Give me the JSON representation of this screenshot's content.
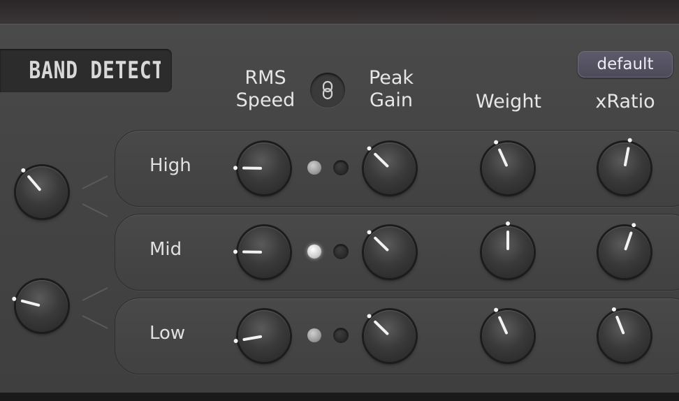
{
  "title": "BAND DETECTOR",
  "headers": {
    "rms_speed": [
      "RMS",
      "Speed"
    ],
    "peak_gain": [
      "Peak",
      "Gain"
    ],
    "weight": "Weight",
    "xratio": "xRatio"
  },
  "default_button": "default",
  "link_icon": "link-chain-icon",
  "side_knobs": [
    {
      "name": "crossover-high-knob",
      "value": 0.35
    },
    {
      "name": "crossover-low-knob",
      "value": 0.22
    }
  ],
  "bands": [
    {
      "label": "High",
      "rms_speed": 0.17,
      "led_rms": "dim",
      "led_peak": "off",
      "peak_gain": 0.33,
      "weight": 0.41,
      "xratio": 0.54
    },
    {
      "label": "Mid",
      "rms_speed": 0.17,
      "led_rms": "on",
      "led_peak": "off",
      "peak_gain": 0.33,
      "weight": 0.5,
      "xratio": 0.57
    },
    {
      "label": "Low",
      "rms_speed": 0.13,
      "led_rms": "dim",
      "led_peak": "off",
      "peak_gain": 0.33,
      "weight": 0.41,
      "xratio": 0.42
    }
  ],
  "colors": {
    "panel": "#444444",
    "row": "#454545",
    "text": "#e6e6e6",
    "accent_button": "#555363"
  }
}
